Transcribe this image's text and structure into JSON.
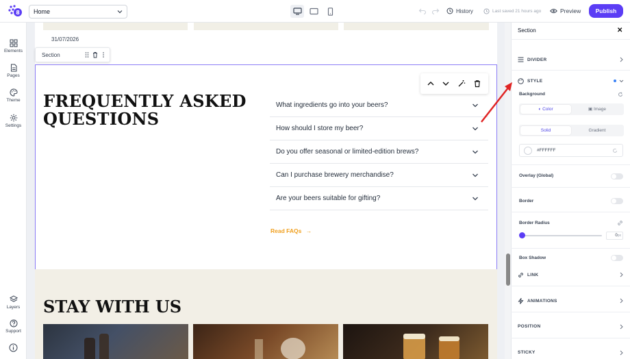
{
  "topbar": {
    "page_select": "Home",
    "history": "History",
    "last_saved": "Last saved 21 hours ago",
    "preview": "Preview",
    "publish": "Publish",
    "publish_color": "#5b3df5"
  },
  "rail": {
    "items": [
      {
        "label": "Elements",
        "icon": "grid-icon"
      },
      {
        "label": "Pages",
        "icon": "page-icon"
      },
      {
        "label": "Theme",
        "icon": "palette-icon"
      },
      {
        "label": "Settings",
        "icon": "gear-icon"
      }
    ],
    "bottom": [
      {
        "label": "Layers",
        "icon": "layers-icon"
      },
      {
        "label": "Support",
        "icon": "help-icon"
      }
    ]
  },
  "canvas": {
    "date": "31/07/2026",
    "section_label": "Section",
    "faq_title": "FREQUENTLY ASKED QUESTIONS",
    "faqs": [
      "What ingredients go into your beers?",
      "How should I store my beer?",
      "Do you offer seasonal or limited-edition brews?",
      "Can I purchase brewery merchandise?",
      "Are your beers suitable for gifting?"
    ],
    "read_faqs": "Read FAQs",
    "stay_title": "STAY WITH US",
    "accent": "#f0a020"
  },
  "panel": {
    "title": "Section",
    "divider": "DIVIDER",
    "style": "STYLE",
    "background": "Background",
    "color_tab": "Color",
    "image_tab": "Image",
    "solid_tab": "Solid",
    "gradient_tab": "Gradient",
    "color_value": "#FFFFFF",
    "overlay": "Overlay (Global)",
    "border": "Border",
    "border_radius": "Border Radius",
    "radius_value": "0",
    "radius_unit": "px",
    "box_shadow": "Box Shadow",
    "link": "LINK",
    "animations": "ANIMATIONS",
    "position": "POSITION",
    "sticky": "STICKY"
  }
}
